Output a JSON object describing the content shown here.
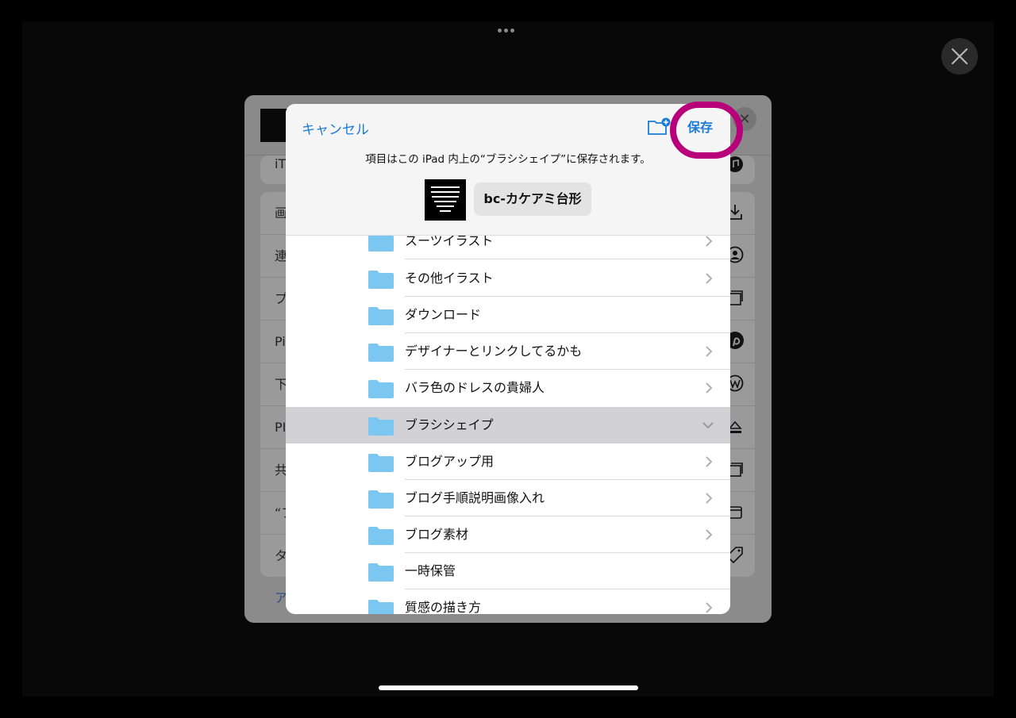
{
  "dialog": {
    "cancel_label": "キャンセル",
    "save_label": "保存",
    "save_note": "項目はこの iPad 内上の“ブラシシェイプ”に保存されます。",
    "filename": "bc-カケアミ台形"
  },
  "folders": [
    {
      "label": "スーツイラスト",
      "chevron": "right"
    },
    {
      "label": "その他イラスト",
      "chevron": "right"
    },
    {
      "label": "ダウンロード",
      "chevron": "none"
    },
    {
      "label": "デザイナーとリンクしてるかも",
      "chevron": "right"
    },
    {
      "label": "バラ色のドレスの貴婦人",
      "chevron": "right"
    },
    {
      "label": "ブラシシェイプ",
      "chevron": "down",
      "selected": true
    },
    {
      "label": "ブログアップ用",
      "chevron": "right"
    },
    {
      "label": "ブログ手順説明画像入れ",
      "chevron": "right"
    },
    {
      "label": "ブログ素材",
      "chevron": "right"
    },
    {
      "label": "一時保管",
      "chevron": "none"
    },
    {
      "label": "質感の描き方",
      "chevron": "right"
    }
  ],
  "share_sheet": {
    "rows_top": [
      {
        "label": "iT"
      }
    ],
    "rows": [
      {
        "label": "画"
      },
      {
        "label": "連"
      },
      {
        "label": "プ"
      },
      {
        "label": "Pi"
      },
      {
        "label": "下"
      },
      {
        "label": "PI"
      },
      {
        "label": "共"
      },
      {
        "label": "“フ"
      },
      {
        "label": "タ"
      }
    ],
    "bottom_link": "ア"
  },
  "colors": {
    "accent": "#1a7bd6",
    "highlight": "#b8007a",
    "folder": "#7cc6f2"
  }
}
